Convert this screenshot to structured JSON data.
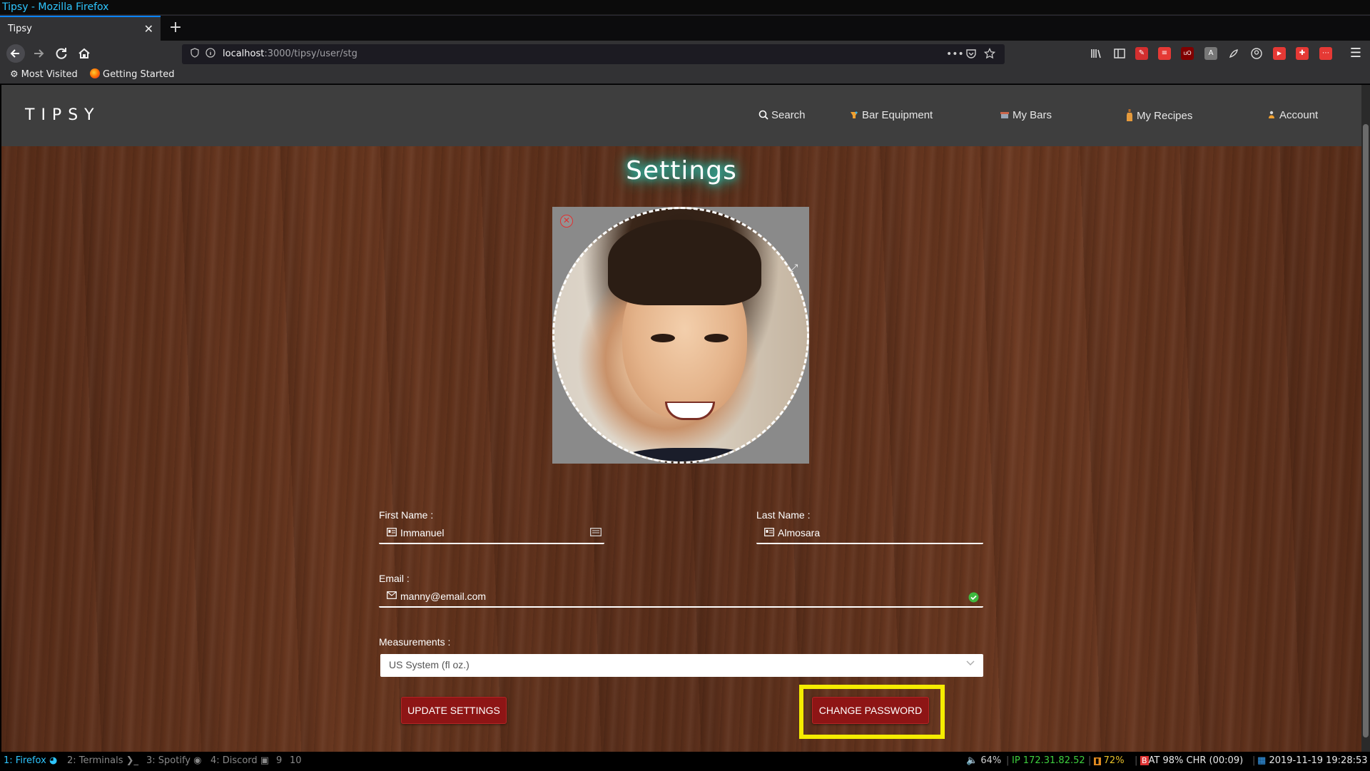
{
  "window": {
    "title": "Tipsy - Mozilla Firefox"
  },
  "browser": {
    "tab_title": "Tipsy",
    "tab_close": "✕",
    "new_tab": "+",
    "url_host": "localhost",
    "url_path": ":3000/tipsy/user/stg",
    "url_actions_more": "•••",
    "bookmarks": [
      {
        "label": "Most Visited",
        "icon": "gear-icon"
      },
      {
        "label": "Getting Started",
        "icon": "firefox-icon"
      }
    ]
  },
  "site": {
    "logo": "TIPSY",
    "menu": [
      {
        "label": "Search",
        "icon": "search-icon"
      },
      {
        "label": "Bar Equipment",
        "icon": "bar-equipment-icon"
      },
      {
        "label": "My Bars",
        "icon": "my-bars-icon"
      },
      {
        "label": "My Recipes",
        "icon": "bottle-icon"
      },
      {
        "label": "Account",
        "icon": "account-icon"
      }
    ]
  },
  "settings": {
    "title": "Settings",
    "first_name_label": "First Name :",
    "first_name_value": "Immanuel",
    "last_name_label": "Last Name :",
    "last_name_value": "Almosara",
    "email_label": "Email :",
    "email_value": "manny@email.com",
    "measurements_label": "Measurements :",
    "measurements_value": "US System (fl oz.)",
    "update_button": "UPDATE SETTINGS",
    "change_password_button": "CHANGE PASSWORD"
  },
  "statusbar": {
    "workspaces": [
      {
        "label": "1: Firefox",
        "active": true
      },
      {
        "label": "2: Terminals",
        "active": false
      },
      {
        "label": "3: Spotify",
        "active": false
      },
      {
        "label": "4: Discord",
        "active": false
      },
      {
        "label": "9",
        "active": false
      },
      {
        "label": "10",
        "active": false
      }
    ],
    "volume": "64%",
    "ip": "IP 172.31.82.52",
    "wifi": "72%",
    "battery": "AT 98% CHR (00:09)",
    "datetime": "2019-11-19 19:28:53"
  },
  "colors": {
    "highlight": "#f5ec00",
    "button_red": "#8e1515",
    "title_glow": "#27d9c8",
    "workspace_active": "#2ec6ff"
  }
}
